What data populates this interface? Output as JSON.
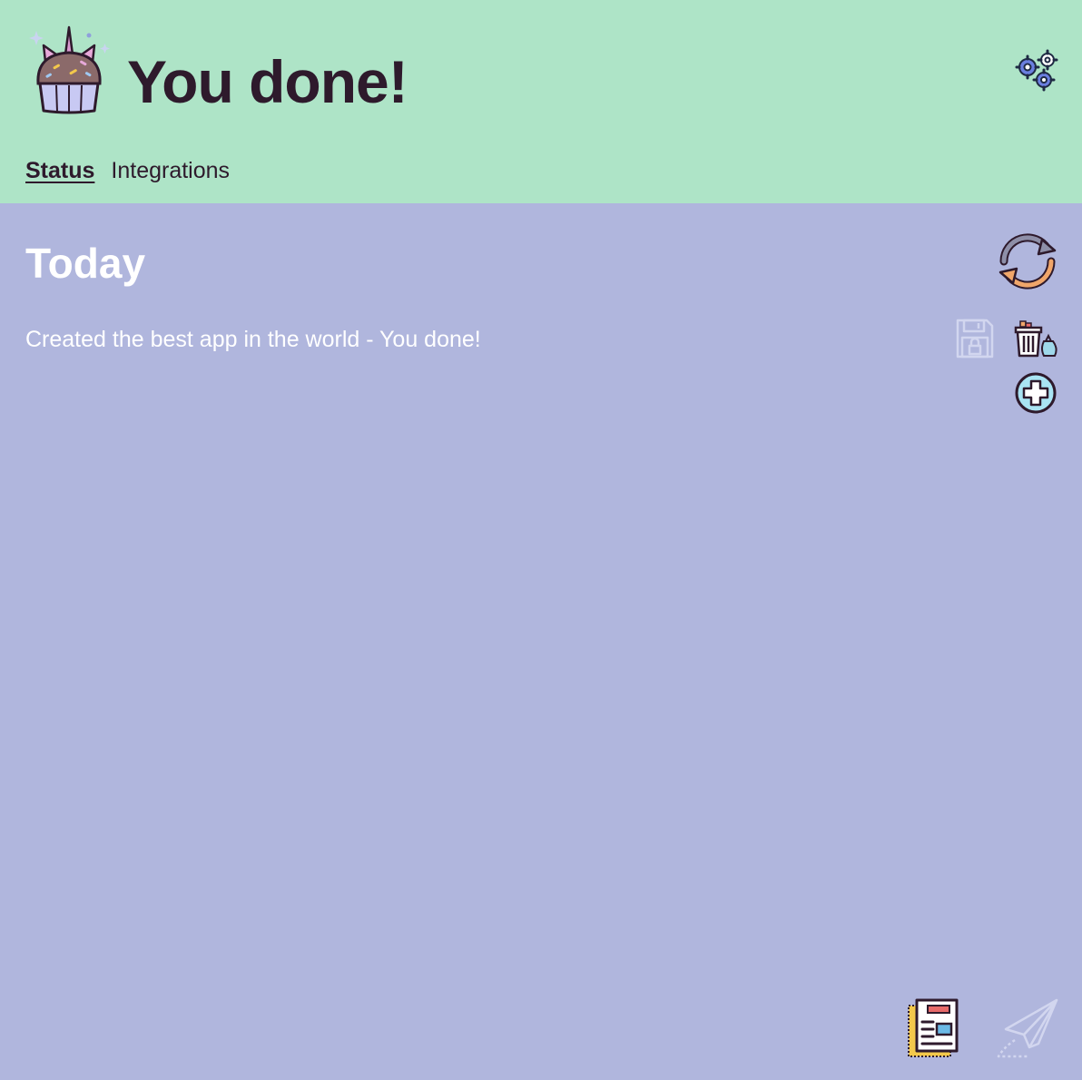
{
  "header": {
    "title": "You done!",
    "logo_icon": "unicorn-cupcake-icon",
    "settings_icon": "gears-icon",
    "background": "#aee4c7"
  },
  "nav": {
    "items": [
      {
        "label": "Status",
        "active": true
      },
      {
        "label": "Integrations",
        "active": false
      }
    ]
  },
  "main": {
    "section_title": "Today",
    "background": "#b0b6dd",
    "entries": [
      {
        "text": "Created the best app in the world - You done!"
      }
    ],
    "icons": {
      "refresh": "refresh-icon",
      "save": "save-disabled-icon",
      "trash": "trash-icon",
      "add": "add-circle-icon",
      "report": "report-document-icon",
      "send": "send-paper-plane-icon"
    }
  }
}
